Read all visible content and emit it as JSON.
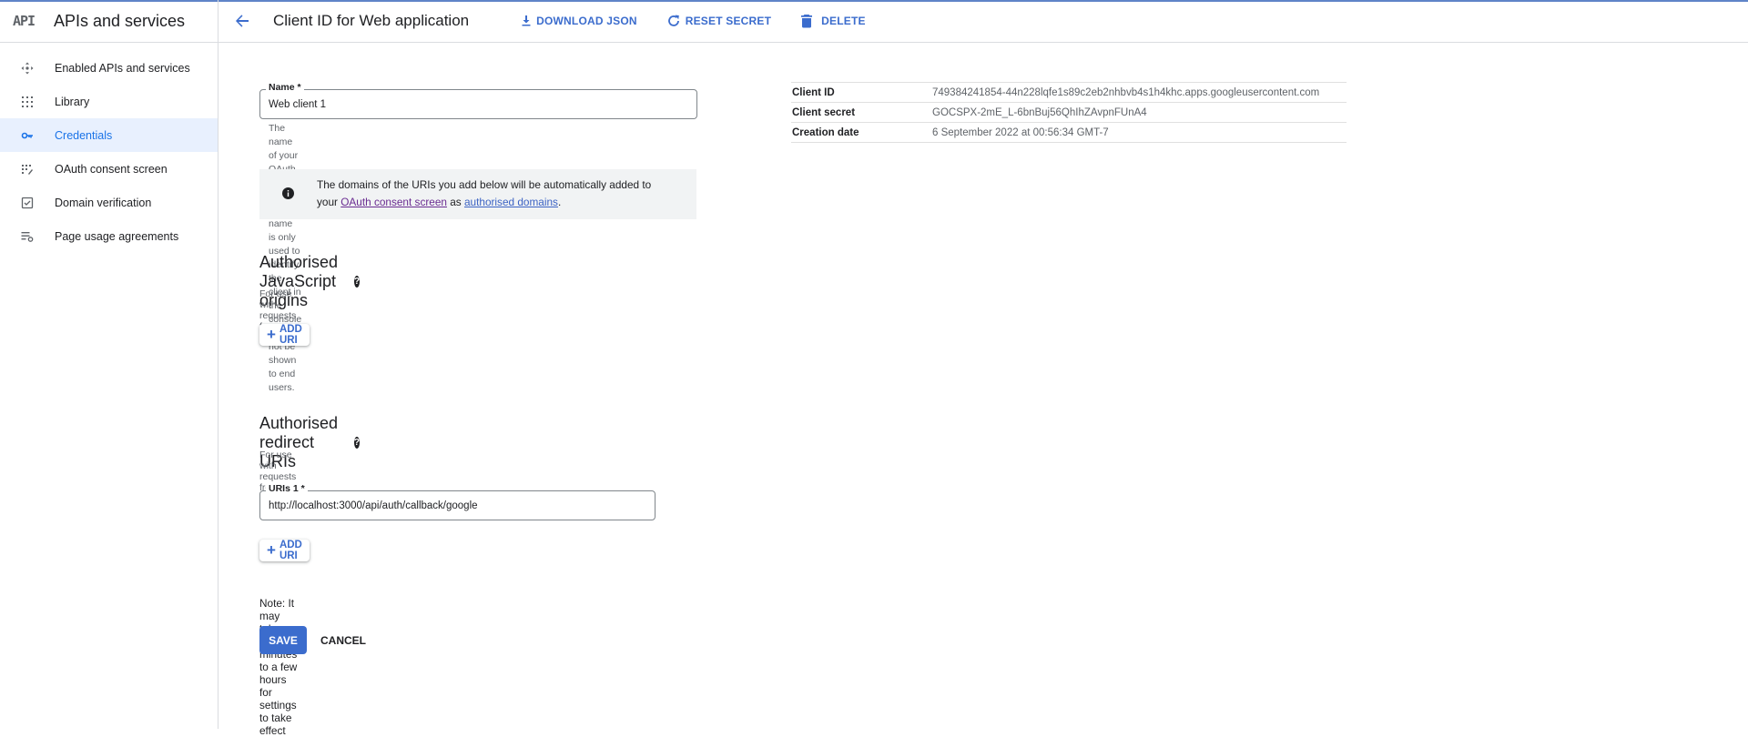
{
  "sidebar": {
    "logo": "API",
    "title": "APIs and services",
    "items": [
      {
        "label": "Enabled APIs and services",
        "icon": "enabled-apis-icon"
      },
      {
        "label": "Library",
        "icon": "library-icon"
      },
      {
        "label": "Credentials",
        "icon": "key-icon",
        "active": true
      },
      {
        "label": "OAuth consent screen",
        "icon": "oauth-consent-icon"
      },
      {
        "label": "Domain verification",
        "icon": "domain-verification-icon"
      },
      {
        "label": "Page usage agreements",
        "icon": "page-usage-icon"
      }
    ]
  },
  "header": {
    "title": "Client ID for Web application",
    "download_json": "DOWNLOAD JSON",
    "reset_secret": "RESET SECRET",
    "delete": "DELETE"
  },
  "form": {
    "name_label": "Name *",
    "name_value": "Web client 1",
    "name_hint_1": "The name of your OAuth 2.0 client. This name is only used to identify the client in the",
    "name_hint_2": "console and will not be shown to end users.",
    "info_1": "The domains of the URIs you add below will be automatically added to",
    "info_2a": "your ",
    "info_link1": "OAuth consent screen",
    "info_2b": " as ",
    "info_link2": "authorised domains",
    "info_2c": ".",
    "js_origins_title": "Authorised JavaScript origins",
    "js_origins_sub": "For use with requests from a browser",
    "redirect_title": "Authorised redirect URIs",
    "redirect_sub": "For use with requests from a web server",
    "uri_label": "URIs 1 *",
    "uri_value": "http://localhost:3000/api/auth/callback/google",
    "add_uri": "ADD URI",
    "note": "Note: It may take five minutes to a few hours for settings to take effect",
    "save": "SAVE",
    "cancel": "CANCEL"
  },
  "details": [
    {
      "key": "Client ID",
      "value": "749384241854-44n228lqfe1s89c2eb2nhbvb4s1h4khc.apps.googleusercontent.com"
    },
    {
      "key": "Client secret",
      "value": "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"
    },
    {
      "key": "Creation date",
      "value": "6 September 2022 at 00:56:34 GMT-7"
    }
  ],
  "colors": {
    "accent": "#3b6ccd",
    "active_bg": "#e8f0fe"
  }
}
